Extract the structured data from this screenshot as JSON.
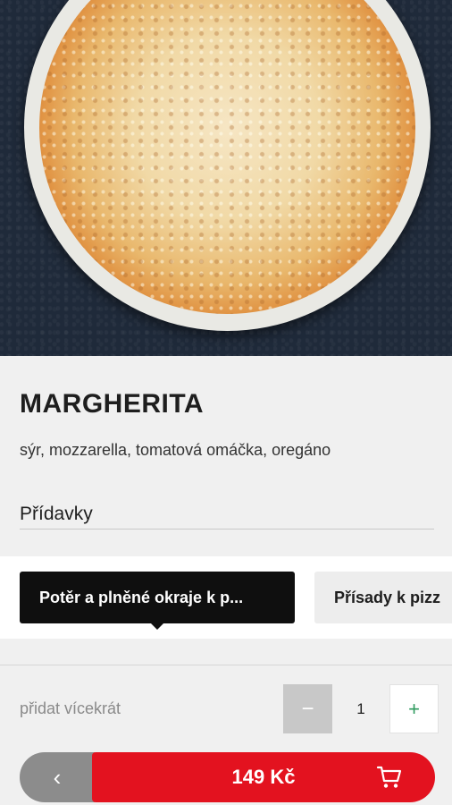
{
  "product": {
    "title": "MARGHERITA",
    "description": "sýr, mozzarella, tomatová omáčka, oregáno"
  },
  "extras": {
    "label": "Přídavky",
    "tabs": [
      {
        "label": "Potěr a plněné okraje k p...",
        "active": true
      },
      {
        "label": "Přísady k pizz",
        "active": false
      }
    ]
  },
  "quantity": {
    "label": "přidat vícekrát",
    "minus_icon": "minus-icon",
    "value": "1",
    "plus_icon": "plus-icon"
  },
  "footer": {
    "back_icon": "chevron-left-icon",
    "price_label": "149 Kč",
    "cart_icon": "cart-icon"
  },
  "colors": {
    "accent_red": "#e3121f",
    "plus_green": "#2e9a5e",
    "tab_active_bg": "#0f0f0f"
  }
}
